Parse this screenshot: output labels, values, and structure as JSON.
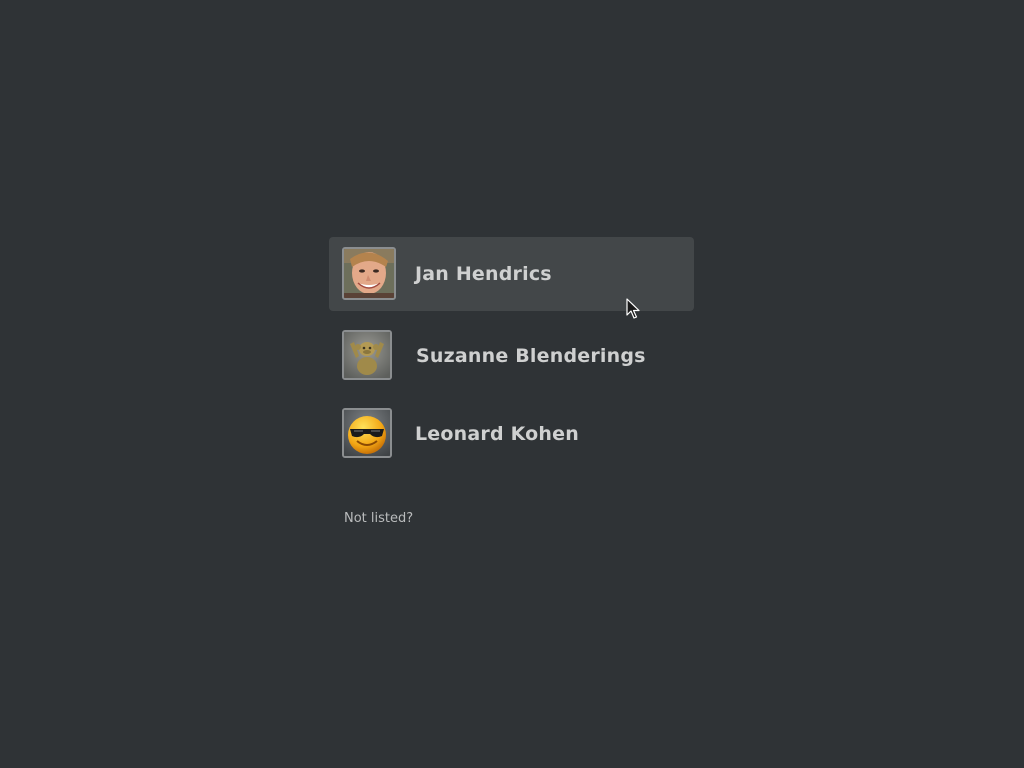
{
  "users": [
    {
      "name": "Jan Hendrics",
      "avatar": "photo-of-smiling-man",
      "selected": true
    },
    {
      "name": "Suzanne Blenderings",
      "avatar": "monkey-figure-icon",
      "selected": false
    },
    {
      "name": "Leonard Kohen",
      "avatar": "smiley-sunglasses-icon",
      "selected": false
    }
  ],
  "not_listed_label": "Not listed?",
  "colors": {
    "background": "#2f3336",
    "selected_row": "#434749",
    "text": "#cfd0d0"
  }
}
